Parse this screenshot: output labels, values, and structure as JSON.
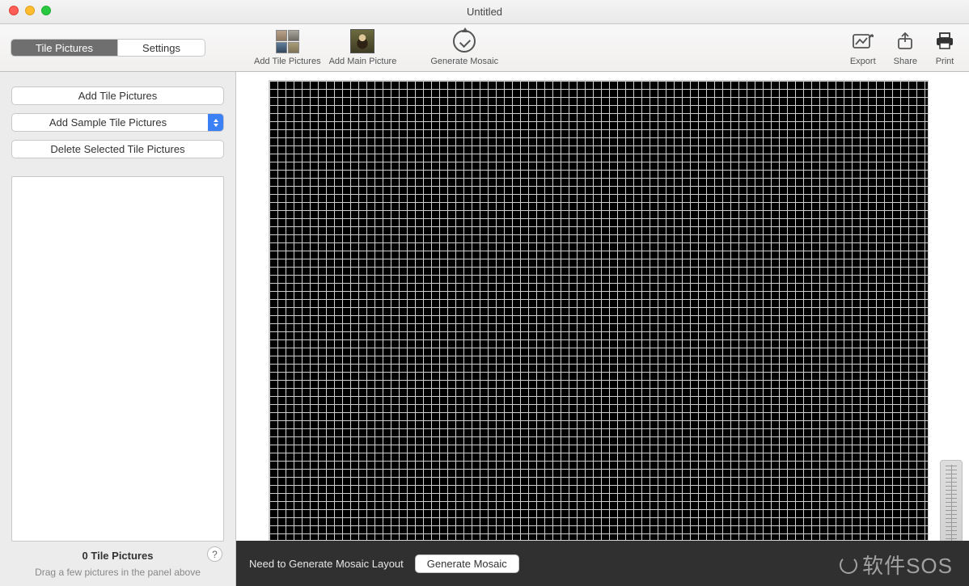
{
  "window": {
    "title": "Untitled"
  },
  "tabs": {
    "tile_pictures": "Tile Pictures",
    "settings": "Settings",
    "active": "tile_pictures"
  },
  "toolbar": {
    "add_tile": "Add Tile Pictures",
    "add_main": "Add Main Picture",
    "generate": "Generate Mosaic",
    "export": "Export",
    "share": "Share",
    "print": "Print"
  },
  "sidebar": {
    "add_tile_btn": "Add Tile Pictures",
    "add_sample_btn": "Add Sample Tile Pictures",
    "delete_btn": "Delete Selected Tile Pictures",
    "count_label": "0 Tile Pictures",
    "hint": "Drag a few pictures in the panel above",
    "help": "?"
  },
  "bottombar": {
    "message": "Need to Generate Mosaic Layout",
    "generate_btn": "Generate Mosaic"
  },
  "watermark": "软件SOS"
}
